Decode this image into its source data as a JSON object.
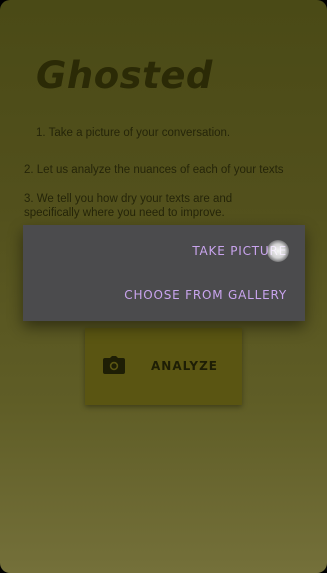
{
  "app": {
    "title": "Ghosted"
  },
  "instructions": {
    "step_1": "1. Take a picture of your conversation.",
    "step_2": "2. Let us analyze the nuances of each of your texts",
    "step_3": "3. We tell you how dry your texts are and specifically where you need to improve."
  },
  "main": {
    "analyze_label": "ANALYZE",
    "analyze_icon": "camera-icon"
  },
  "dialog": {
    "take_picture_label": "TAKE PICTURE",
    "choose_gallery_label": "CHOOSE FROM GALLERY"
  },
  "colors": {
    "accent": "#c9a4ee",
    "dialog_bg": "#4b4b4d",
    "button_bg": "#5a5512",
    "title_color": "#2b2a06"
  }
}
